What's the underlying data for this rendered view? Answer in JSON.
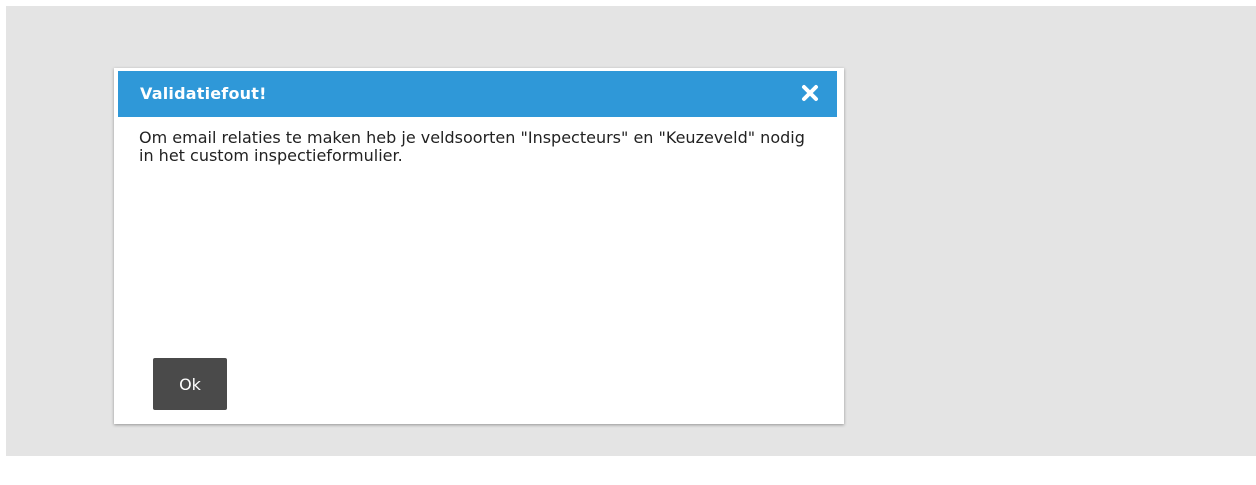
{
  "dialog": {
    "title": "Validatiefout!",
    "close_icon": "close-icon",
    "message": "Om email relaties te maken heb je veldsoorten \"Inspecteurs\" en \"Keuzeveld\" nodig in het custom inspectieformulier.",
    "ok_label": "Ok"
  },
  "colors": {
    "header": "#2f98d8",
    "backdrop": "#e4e4e4",
    "button": "#4a4a4a"
  }
}
